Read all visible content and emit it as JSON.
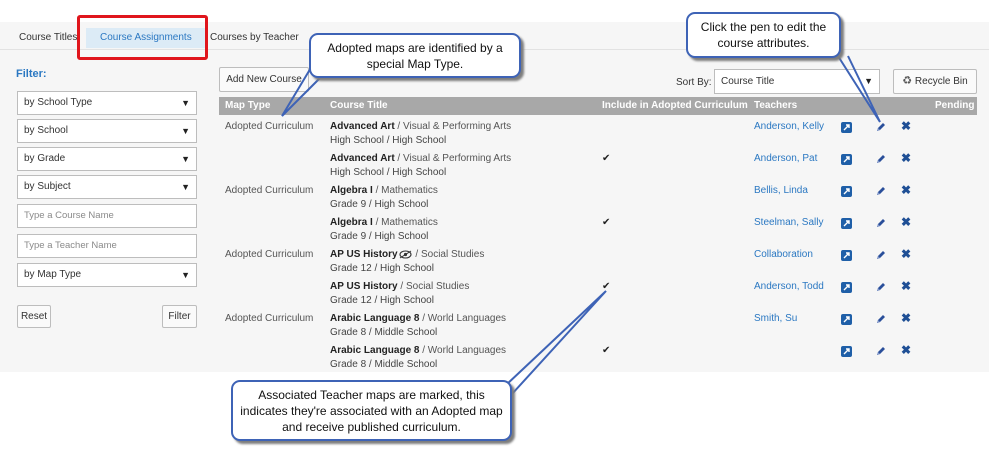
{
  "tabs": [
    {
      "label": "Course Titles"
    },
    {
      "label": "Course Assignments"
    },
    {
      "label": "Courses by Teacher"
    }
  ],
  "filter": {
    "title": "Filter:",
    "school_type": "by School Type",
    "school": "by School",
    "grade": "by Grade",
    "subject": "by Subject",
    "course_name_placeholder": "Type a Course Name",
    "teacher_name_placeholder": "Type a Teacher Name",
    "map_type": "by Map Type",
    "reset_label": "Reset",
    "filter_label": "Filter"
  },
  "toolbar": {
    "add_new_course": "Add New Course",
    "sort_by_label": "Sort By:",
    "sort_by_value": "Course Title",
    "recycle_bin": "Recycle Bin"
  },
  "table": {
    "headers": [
      "Map Type",
      "Course Title",
      "Include in Adopted Curriculum",
      "Teachers",
      "Pending"
    ],
    "rows": [
      {
        "map_type": "Adopted Curriculum",
        "course": "Advanced Art",
        "subject": " / Visual & Performing Arts",
        "grade": "High School / High School",
        "included": "",
        "teacher": "Anderson, Kelly"
      },
      {
        "map_type": "",
        "course": "Advanced Art",
        "subject": " / Visual & Performing Arts",
        "grade": "High School / High School",
        "included": "✔",
        "teacher": "Anderson, Pat"
      },
      {
        "map_type": "Adopted Curriculum",
        "course": "Algebra I",
        "subject": " / Mathematics",
        "grade": "Grade 9 / High School",
        "included": "",
        "teacher": "Bellis, Linda"
      },
      {
        "map_type": "",
        "course": "Algebra I",
        "subject": " / Mathematics",
        "grade": "Grade 9 / High School",
        "included": "✔",
        "teacher": "Steelman, Sally"
      },
      {
        "map_type": "Adopted Curriculum",
        "course": "AP US History",
        "subject": " / Social Studies",
        "grade": "Grade 12 / High School",
        "included": "",
        "teacher": "Collaboration"
      },
      {
        "map_type": "",
        "course": "AP US History",
        "subject": " / Social Studies",
        "grade": "Grade 12 / High School",
        "included": "✔",
        "teacher": "Anderson, Todd"
      },
      {
        "map_type": "Adopted Curriculum",
        "course": "Arabic Language 8",
        "subject": " / World Languages",
        "grade": "Grade 8 / Middle School",
        "included": "",
        "teacher": "Smith, Su"
      },
      {
        "map_type": "",
        "course": "Arabic Language 8",
        "subject": " / World Languages",
        "grade": "Grade 8 / Middle School",
        "included": "✔",
        "teacher": ""
      }
    ]
  },
  "callouts": {
    "map_type": "Adopted maps are identified by a special Map Type.",
    "pen": "Click the pen to edit the course attributes.",
    "associated": "Associated Teacher maps are marked, this indicates they're associated with an Adopted map and receive published curriculum."
  },
  "icons": {
    "open": "open-map-icon",
    "edit": "pencil-icon",
    "delete": "close-icon",
    "recycle": "recycle-icon",
    "view": "eye-icon"
  },
  "colors": {
    "accent": "#2b78c2",
    "highlight_box": "#e0151c",
    "callout_border": "#3e63b6",
    "header_bg": "#a8a8a8"
  }
}
